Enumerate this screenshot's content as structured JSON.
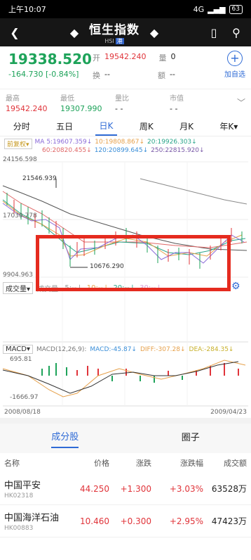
{
  "status": {
    "time": "上午10:07",
    "battery": "63",
    "network": "4G"
  },
  "header": {
    "title": "恒生指数",
    "subtitle": "HSI",
    "tag": "港"
  },
  "quote": {
    "price": "19338.520",
    "change": "-164.730",
    "change_pct": "[-0.84%]",
    "open_label": "开",
    "open": "19542.240",
    "volume_label": "量",
    "volume": "0",
    "turnover_label": "换",
    "turnover": "--",
    "amount_label": "额",
    "amount": "--",
    "add_label": "加自选"
  },
  "stats": [
    {
      "label": "最高",
      "value": "19542.240",
      "color": "#e0343a"
    },
    {
      "label": "最低",
      "value": "19307.990",
      "color": "#1ea35a"
    },
    {
      "label": "量比",
      "value": "- -",
      "color": "#222222"
    },
    {
      "label": "市值",
      "value": "- -",
      "color": "#222222"
    }
  ],
  "period_tabs": [
    "分时",
    "五日",
    "日K",
    "周K",
    "月K",
    "年K▾"
  ],
  "active_period": "日K",
  "ma": {
    "fq": "前复权▾",
    "ma5": "MA 5:19607.359↓",
    "ma10": "10:19808.867↓",
    "ma20": "20:19926.303↓",
    "ma60": "60:20820.455↓",
    "ma120": "120:20899.645↓",
    "ma250": "250:22815.920↓"
  },
  "axis": {
    "top": "24156.598",
    "high_mark": "21546.939",
    "mid": "17030.778",
    "bottom": "9904.963",
    "low_mark": "10676.290",
    "macd_top": "695.81",
    "macd_bottom": "-1666.97"
  },
  "volume": {
    "selector": "成交量▾",
    "label": "成交量:",
    "v5": "5:--↓",
    "v10": "10:--↓",
    "v20": "20:--↓",
    "v30": "30:--↓"
  },
  "macd": {
    "selector": "MACD▾",
    "params": "MACD(12,26,9):",
    "macd": "MACD:-45.87↓",
    "diff": "DIFF:-307.28↓",
    "dea": "DEA:-284.35↓"
  },
  "dates": {
    "start": "2008/08/18",
    "end": "2009/04/23"
  },
  "section_tabs": [
    "成分股",
    "圈子"
  ],
  "table": {
    "headers": [
      "名称",
      "价格",
      "涨跌",
      "涨跌幅",
      "成交额"
    ],
    "rows": [
      {
        "name": "中国平安",
        "code": "HK02318",
        "price": "44.250",
        "change": "+1.300",
        "pct": "+3.03%",
        "amount": "63528万"
      },
      {
        "name": "中国海洋石油",
        "code": "HK00883",
        "price": "10.460",
        "change": "+0.300",
        "pct": "+2.95%",
        "amount": "47423万"
      }
    ]
  }
}
